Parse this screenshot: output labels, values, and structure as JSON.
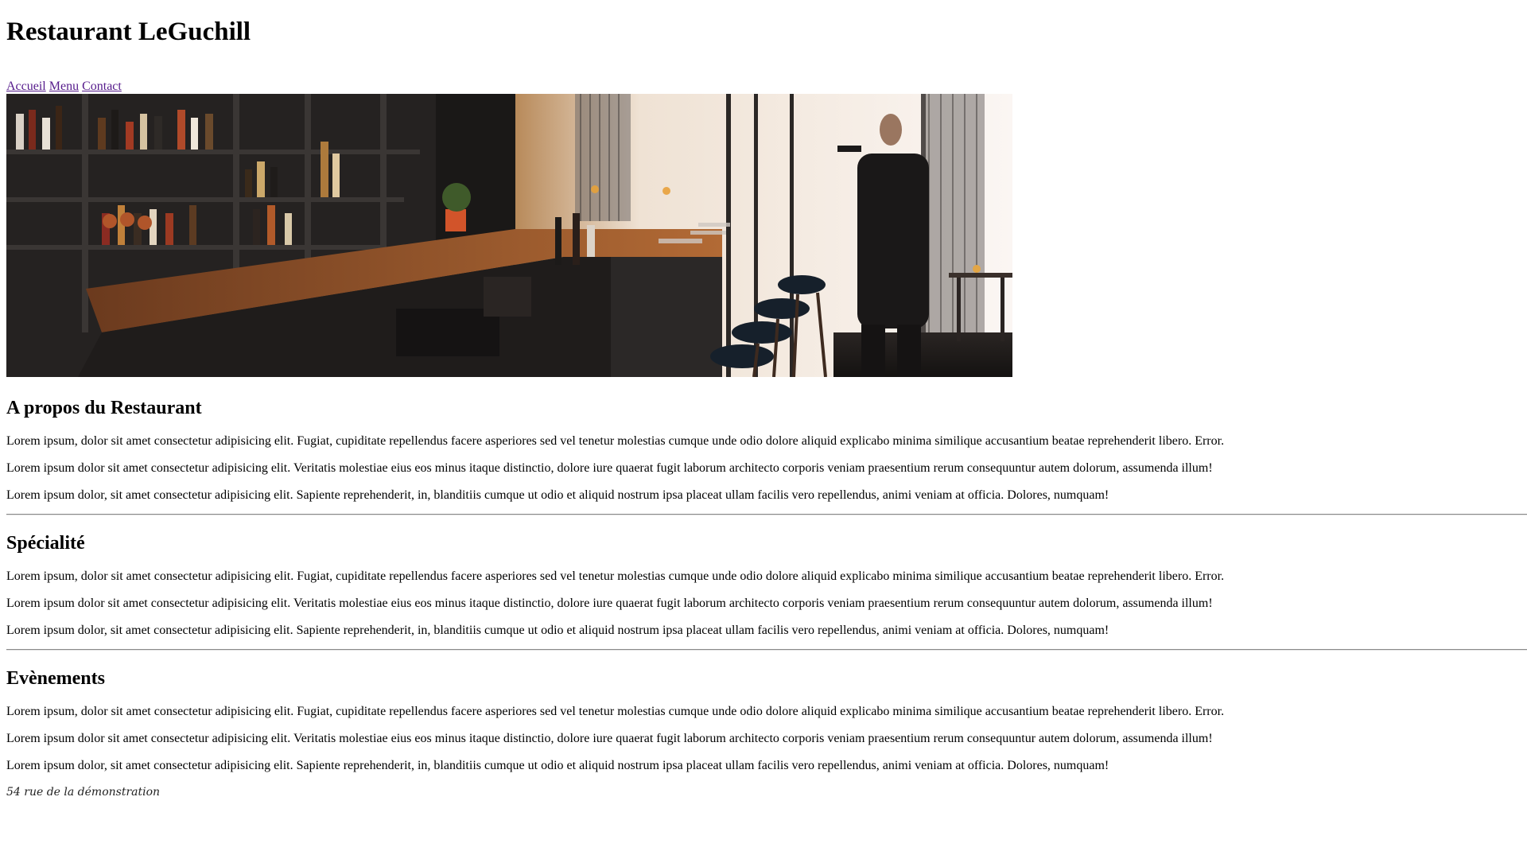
{
  "header": {
    "title": "Restaurant LeGuchill"
  },
  "nav": {
    "items": [
      {
        "label": "Accueil"
      },
      {
        "label": "Menu"
      },
      {
        "label": "Contact"
      }
    ]
  },
  "sections": [
    {
      "title": "A propos du Restaurant",
      "paragraphs": [
        "Lorem ipsum, dolor sit amet consectetur adipisicing elit. Fugiat, cupiditate repellendus facere asperiores sed vel tenetur molestias cumque unde odio dolore aliquid explicabo minima similique accusantium beatae reprehenderit libero. Error.",
        "Lorem ipsum dolor sit amet consectetur adipisicing elit. Veritatis molestiae eius eos minus itaque distinctio, dolore iure quaerat fugit laborum architecto corporis veniam praesentium rerum consequuntur autem dolorum, assumenda illum!",
        "Lorem ipsum dolor, sit amet consectetur adipisicing elit. Sapiente reprehenderit, in, blanditiis cumque ut odio et aliquid nostrum ipsa placeat ullam facilis vero repellendus, animi veniam at officia. Dolores, numquam!"
      ]
    },
    {
      "title": "Spécialité",
      "paragraphs": [
        "Lorem ipsum, dolor sit amet consectetur adipisicing elit. Fugiat, cupiditate repellendus facere asperiores sed vel tenetur molestias cumque unde odio dolore aliquid explicabo minima similique accusantium beatae reprehenderit libero. Error.",
        "Lorem ipsum dolor sit amet consectetur adipisicing elit. Veritatis molestiae eius eos minus itaque distinctio, dolore iure quaerat fugit laborum architecto corporis veniam praesentium rerum consequuntur autem dolorum, assumenda illum!",
        "Lorem ipsum dolor, sit amet consectetur adipisicing elit. Sapiente reprehenderit, in, blanditiis cumque ut odio et aliquid nostrum ipsa placeat ullam facilis vero repellendus, animi veniam at officia. Dolores, numquam!"
      ]
    },
    {
      "title": "Evènements",
      "paragraphs": [
        "Lorem ipsum, dolor sit amet consectetur adipisicing elit. Fugiat, cupiditate repellendus facere asperiores sed vel tenetur molestias cumque unde odio dolore aliquid explicabo minima similique accusantium beatae reprehenderit libero. Error.",
        "Lorem ipsum dolor sit amet consectetur adipisicing elit. Veritatis molestiae eius eos minus itaque distinctio, dolore iure quaerat fugit laborum architecto corporis veniam praesentium rerum consequuntur autem dolorum, assumenda illum!",
        "Lorem ipsum dolor, sit amet consectetur adipisicing elit. Sapiente reprehenderit, in, blanditiis cumque ut odio et aliquid nostrum ipsa placeat ullam facilis vero repellendus, animi veniam at officia. Dolores, numquam!"
      ]
    }
  ],
  "footer": {
    "address": "54 rue de la démonstration"
  },
  "colors": {
    "link": "#551a8b",
    "text": "#000000",
    "background": "#ffffff"
  }
}
